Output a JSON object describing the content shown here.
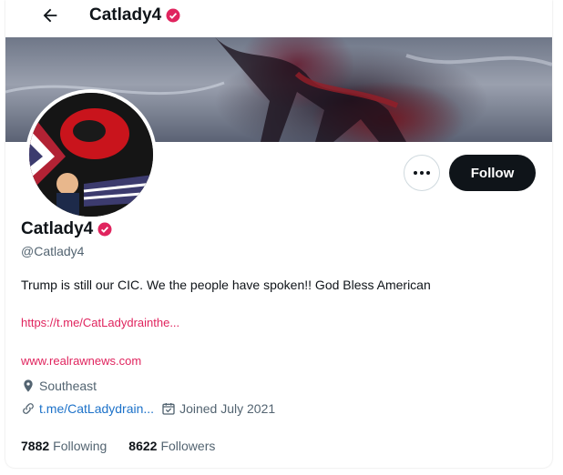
{
  "header": {
    "title": "Catlady4"
  },
  "profile": {
    "display_name": "Catlady4",
    "handle": "@Catlady4",
    "bio": "Trump is still our CIC. We the people have spoken!!  God Bless American",
    "bio_link": "https://t.me/CatLadydrainthe...",
    "website": "www.realrawnews.com",
    "location": "Southeast",
    "link": "t.me/CatLadydrain...",
    "joined": "Joined July 2021",
    "following_count": "7882",
    "following_label": "Following",
    "followers_count": "8622",
    "followers_label": "Followers"
  },
  "actions": {
    "follow_label": "Follow"
  },
  "colors": {
    "accent": "#e0245e",
    "link": "#1d72c9",
    "button": "#0f1419"
  }
}
